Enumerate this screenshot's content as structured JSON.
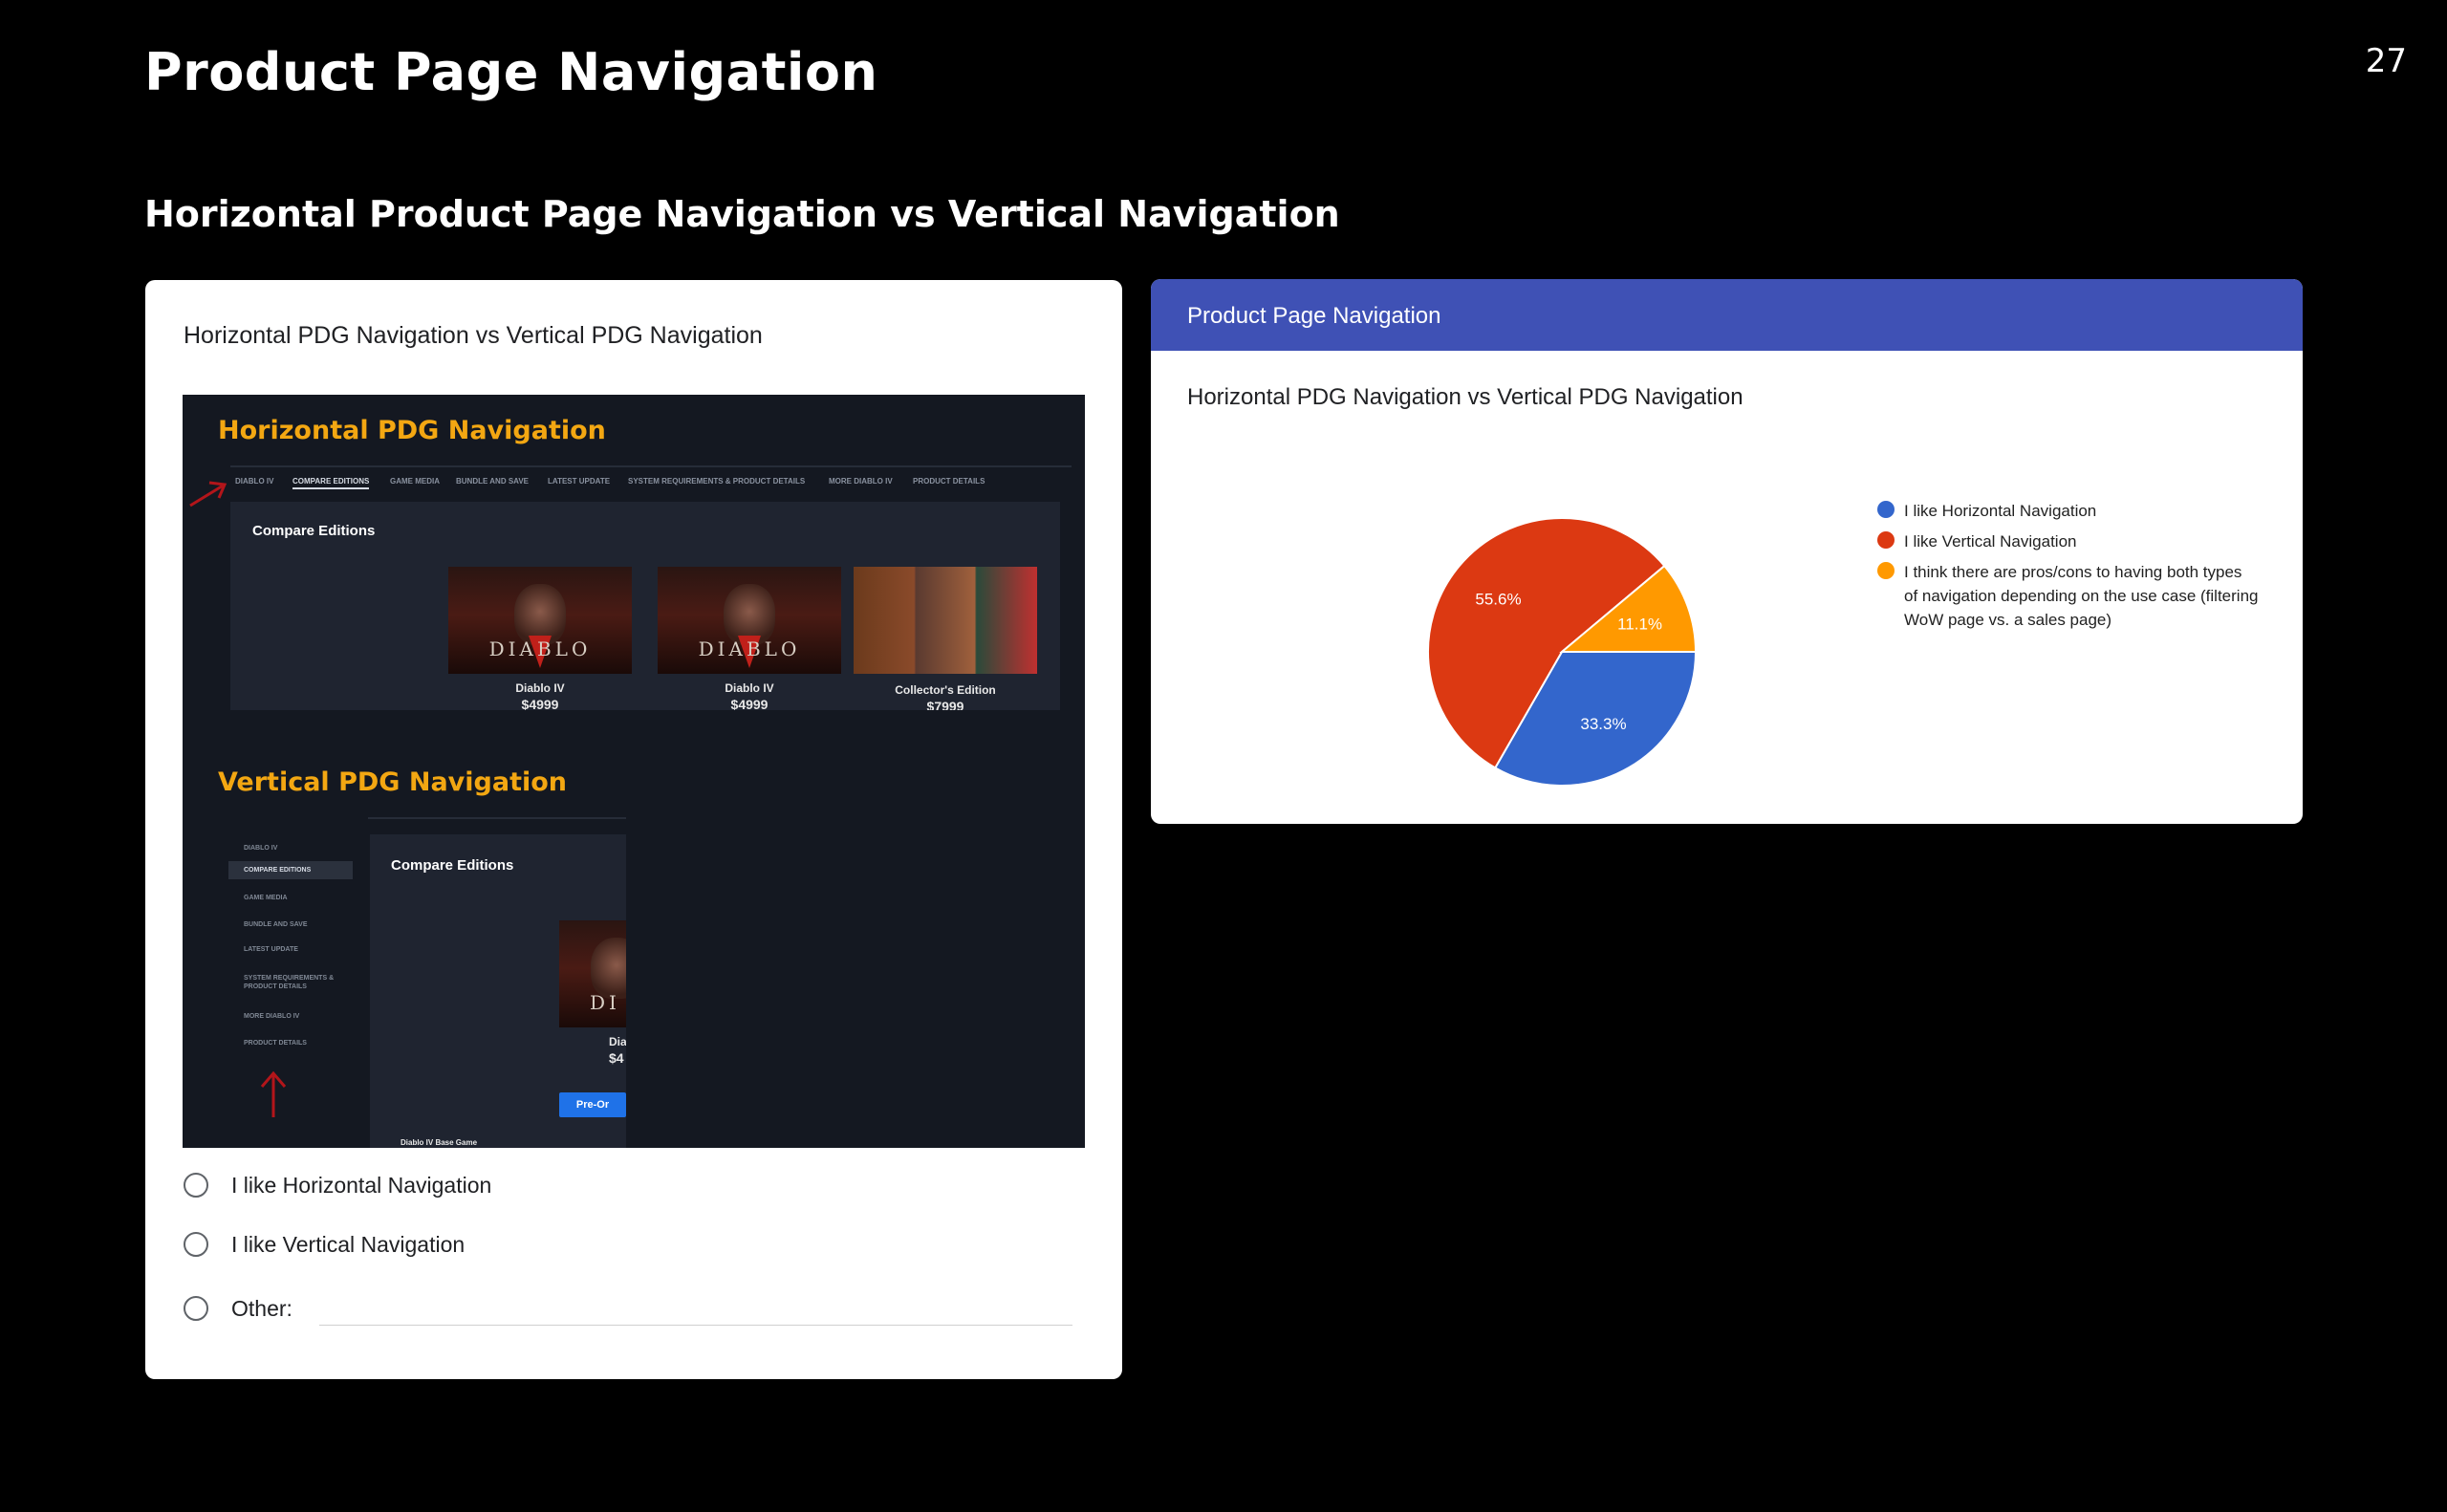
{
  "slide": {
    "title": "Product Page Navigation",
    "page_number": "27",
    "section_title": "Horizontal Product Page Navigation vs Vertical Navigation"
  },
  "form": {
    "question": "Horizontal PDG Navigation vs Vertical PDG Navigation",
    "image": {
      "horizontal_heading": "Horizontal PDG Navigation",
      "horizontal_nav": [
        "DIABLO IV",
        "COMPARE EDITIONS",
        "GAME MEDIA",
        "BUNDLE AND SAVE",
        "LATEST UPDATE",
        "SYSTEM REQUIREMENTS & PRODUCT DETAILS",
        "MORE DIABLO IV",
        "PRODUCT DETAILS"
      ],
      "compare_title": "Compare Editions",
      "editions": [
        {
          "name": "Diablo IV",
          "price": "$4999"
        },
        {
          "name": "Diablo IV",
          "price": "$4999"
        },
        {
          "name": "Collector's Edition",
          "price": "$7999"
        }
      ],
      "logo_text": "DIABLO",
      "vertical_heading": "Vertical PDG Navigation",
      "vertical_nav": [
        "DIABLO IV",
        "COMPARE EDITIONS",
        "GAME MEDIA",
        "BUNDLE AND SAVE",
        "LATEST UPDATE",
        "SYSTEM REQUIREMENTS & PRODUCT DETAILS",
        "MORE DIABLO IV",
        "PRODUCT DETAILS"
      ],
      "vertical_compare_title": "Compare Editions",
      "vertical_logo_text": "DI",
      "vertical_caption": "Diab",
      "vertical_price": "$4",
      "preorder_label": "Pre-Or",
      "base_game_label": "Diablo IV Base Game"
    },
    "options": [
      "I like Horizontal Navigation",
      "I like Vertical Navigation",
      "Other:"
    ]
  },
  "results": {
    "header": "Product Page Navigation",
    "question": "Horizontal PDG Navigation vs Vertical PDG Navigation"
  },
  "chart_data": {
    "type": "pie",
    "title": "Horizontal PDG Navigation vs Vertical PDG Navigation",
    "categories": [
      "I like Horizontal Navigation",
      "I like Vertical Navigation",
      "I think there are pros/cons to having both types of navigation depending on the use case (filtering WoW page vs. a sales page)"
    ],
    "values": [
      33.3,
      55.6,
      11.1
    ],
    "labels": [
      "33.3%",
      "55.6%",
      "11.1%"
    ],
    "colors": [
      "#3366cc",
      "#dc3912",
      "#ff9900"
    ],
    "legend_position": "right"
  }
}
